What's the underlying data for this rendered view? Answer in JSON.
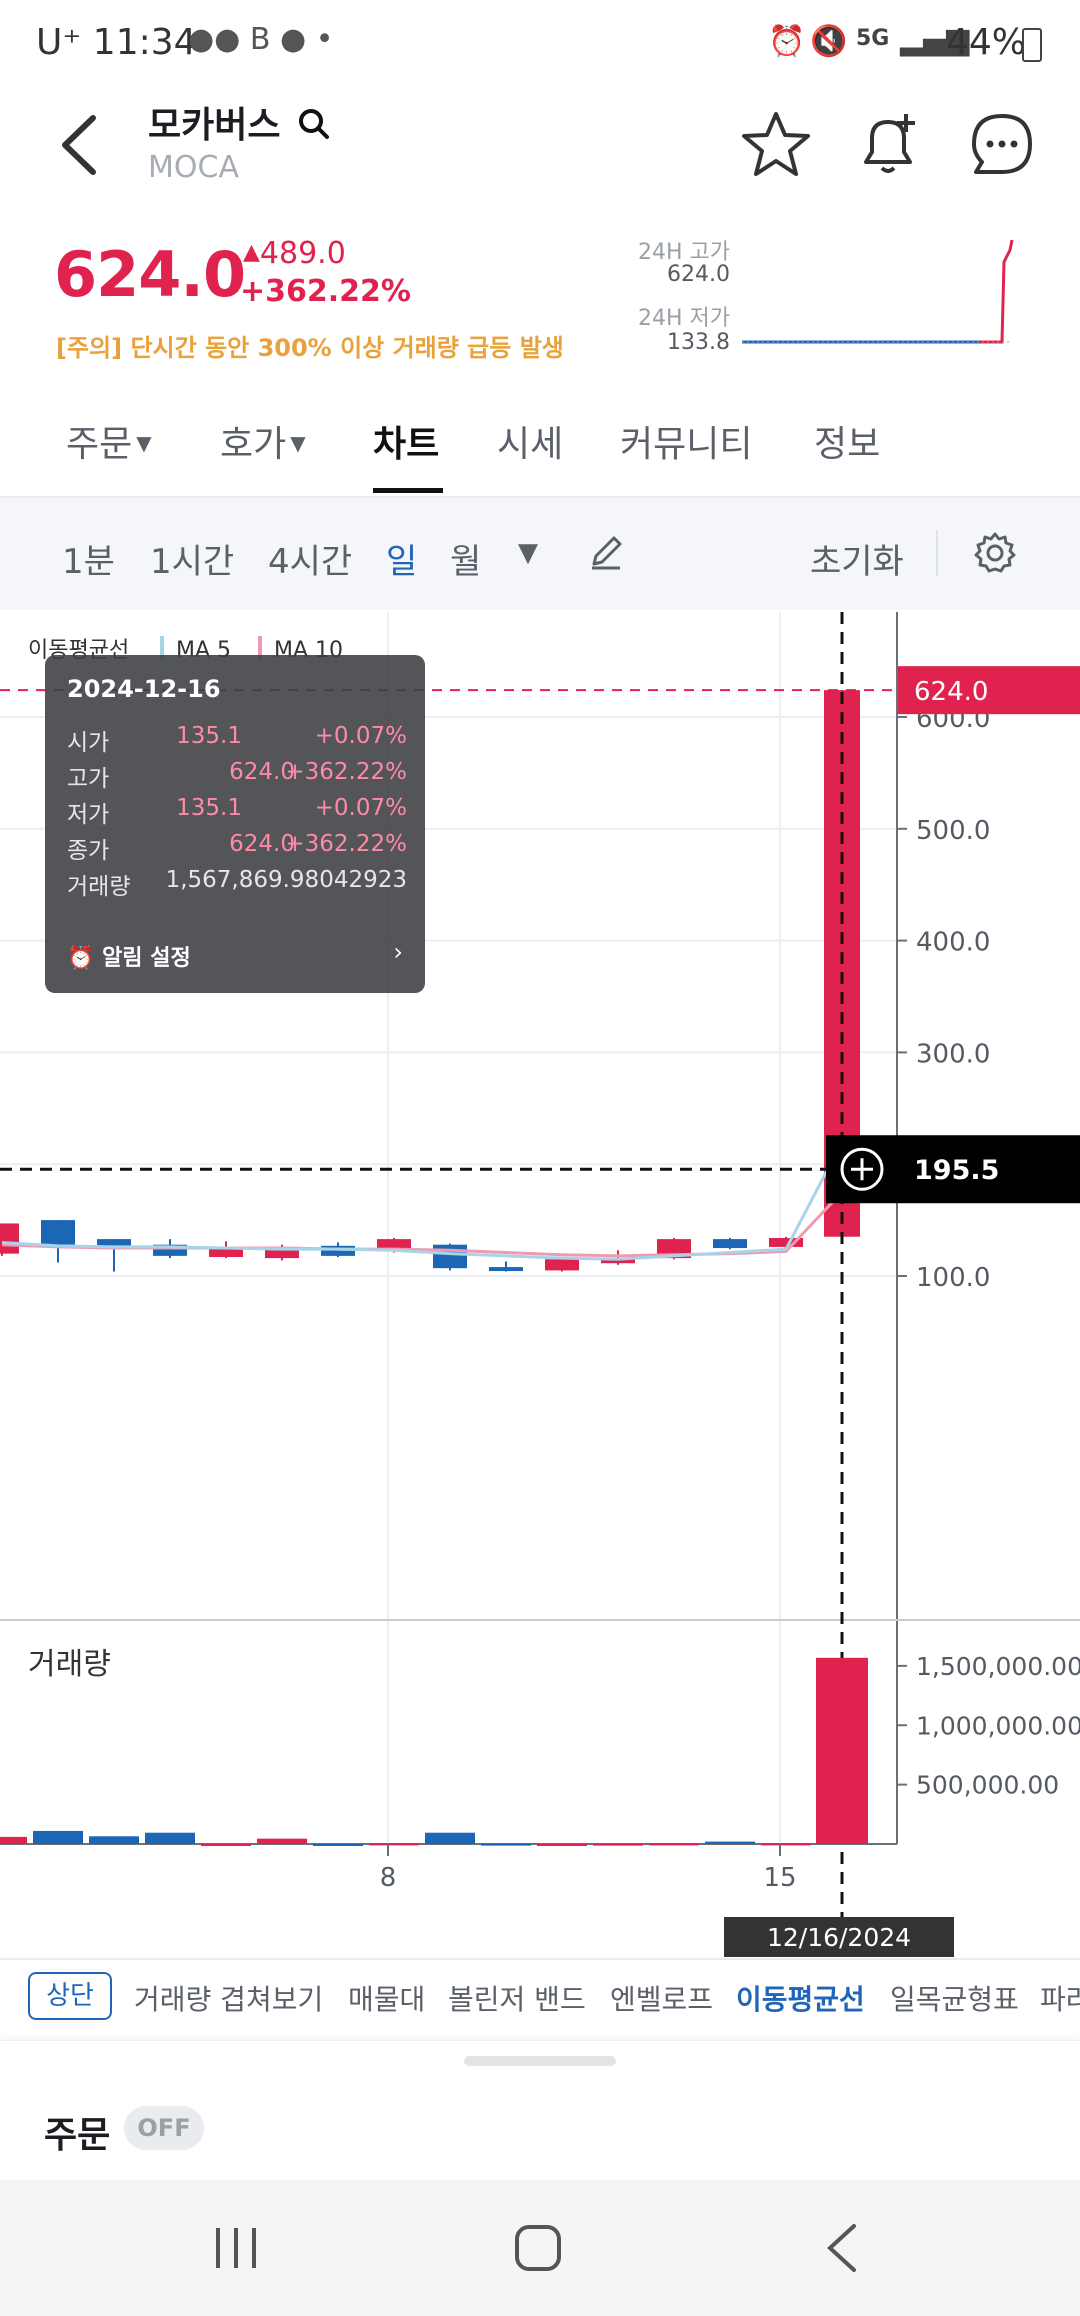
{
  "status_bar": {
    "time": "U⁺ 11:34",
    "battery": "44%",
    "network": "5G"
  },
  "header": {
    "name": "모카버스",
    "symbol": "MOCA"
  },
  "price": {
    "current": "624.0",
    "change": "489.0",
    "change_pct": "+362.22%",
    "warning": "[주의] 단시간 동안 300% 이상 거래량 급등 발생",
    "high_label": "24H 고가",
    "high_value": "624.0",
    "low_label": "24H 저가",
    "low_value": "133.8"
  },
  "tabs": [
    "주문",
    "호가",
    "차트",
    "시세",
    "커뮤니티",
    "정보"
  ],
  "toolbar": {
    "intervals": [
      "1분",
      "1시간",
      "4시간",
      "일",
      "월"
    ],
    "reset": "초기화"
  },
  "chart_data": {
    "type": "candlestick",
    "legend": [
      "이동평균선",
      "MA 5",
      "MA 10"
    ],
    "yaxis_ticks": [
      "600.0",
      "500.0",
      "400.0",
      "300.0",
      "100.0"
    ],
    "ylim": [
      65,
      650
    ],
    "current_price_label": "624.0",
    "crosshair_price_label": "195.5",
    "crosshair_date_label": "12/16/2024",
    "xaxis_ticks": [
      "8",
      "15"
    ],
    "candles": [
      {
        "open": 147,
        "close": 120,
        "high": 147,
        "low": 118,
        "dir": "up"
      },
      {
        "open": 150,
        "close": 128,
        "high": 150,
        "low": 112,
        "dir": "down"
      },
      {
        "open": 133,
        "close": 124,
        "high": 133,
        "low": 104,
        "dir": "down"
      },
      {
        "open": 128,
        "close": 118,
        "high": 133,
        "low": 116,
        "dir": "down"
      },
      {
        "open": 117,
        "close": 126,
        "high": 131,
        "low": 116,
        "dir": "up"
      },
      {
        "open": 116,
        "close": 126,
        "high": 128,
        "low": 114,
        "dir": "up"
      },
      {
        "open": 127,
        "close": 118,
        "high": 130,
        "low": 117,
        "dir": "down"
      },
      {
        "open": 123,
        "close": 133,
        "high": 134,
        "low": 121,
        "dir": "up"
      },
      {
        "open": 128,
        "close": 107,
        "high": 129,
        "low": 105,
        "dir": "down"
      },
      {
        "open": 108,
        "close": 106,
        "high": 113,
        "low": 104,
        "dir": "down"
      },
      {
        "open": 105,
        "close": 115,
        "high": 116,
        "low": 104,
        "dir": "up"
      },
      {
        "open": 112,
        "close": 115,
        "high": 123,
        "low": 110,
        "dir": "up"
      },
      {
        "open": 116,
        "close": 133,
        "high": 134,
        "low": 115,
        "dir": "up"
      },
      {
        "open": 133,
        "close": 125,
        "high": 134,
        "low": 124,
        "dir": "down"
      },
      {
        "open": 126,
        "close": 134,
        "high": 135,
        "low": 125,
        "dir": "up"
      },
      {
        "open": 135.1,
        "close": 624.0,
        "high": 624.0,
        "low": 135.1,
        "dir": "up"
      }
    ],
    "ma5": [
      130,
      127,
      126,
      126,
      125,
      124,
      124,
      123,
      120,
      118,
      116,
      115,
      118,
      121,
      124,
      220
    ],
    "ma10": [
      128,
      126,
      125,
      125,
      125,
      125,
      124,
      124,
      123,
      121,
      119,
      118,
      119,
      120,
      122,
      175
    ],
    "volume": {
      "label": "거래량",
      "ticks": [
        "1,500,000.00",
        "1,000,000.00",
        "500,000.00"
      ],
      "ylim": [
        0,
        1600000
      ],
      "values": [
        60000,
        110000,
        65000,
        95000,
        0,
        45000,
        0,
        5000,
        95000,
        3000,
        0,
        3000,
        5000,
        20000,
        5000,
        1567870
      ],
      "dirs": [
        "up",
        "down",
        "down",
        "down",
        "up",
        "up",
        "down",
        "up",
        "down",
        "down",
        "up",
        "up",
        "up",
        "down",
        "up",
        "up"
      ]
    }
  },
  "tooltip": {
    "date": "2024-12-16",
    "rows": [
      {
        "label": "시가",
        "value": "135.1",
        "pct": "+0.07%"
      },
      {
        "label": "고가",
        "value": "624.0",
        "pct": "+362.22%"
      },
      {
        "label": "저가",
        "value": "135.1",
        "pct": "+0.07%"
      },
      {
        "label": "종가",
        "value": "624.0",
        "pct": "+362.22%"
      }
    ],
    "volume_label": "거래량",
    "volume_value": "1,567,869.98042923",
    "alarm": "알림 설정"
  },
  "indicators": {
    "position": "상단",
    "items": [
      "거래량 겹쳐보기",
      "매물대",
      "볼린저 밴드",
      "엔벨로프",
      "이동평균선",
      "일목균형표",
      "파라"
    ]
  },
  "order_panel": {
    "title": "주문",
    "toggle": "OFF"
  },
  "colors": {
    "up": "#e0234e",
    "down": "#1c66b6",
    "ma5": "#a8d4ea",
    "ma10": "#ef9ab0",
    "accent": "#2165b8"
  }
}
